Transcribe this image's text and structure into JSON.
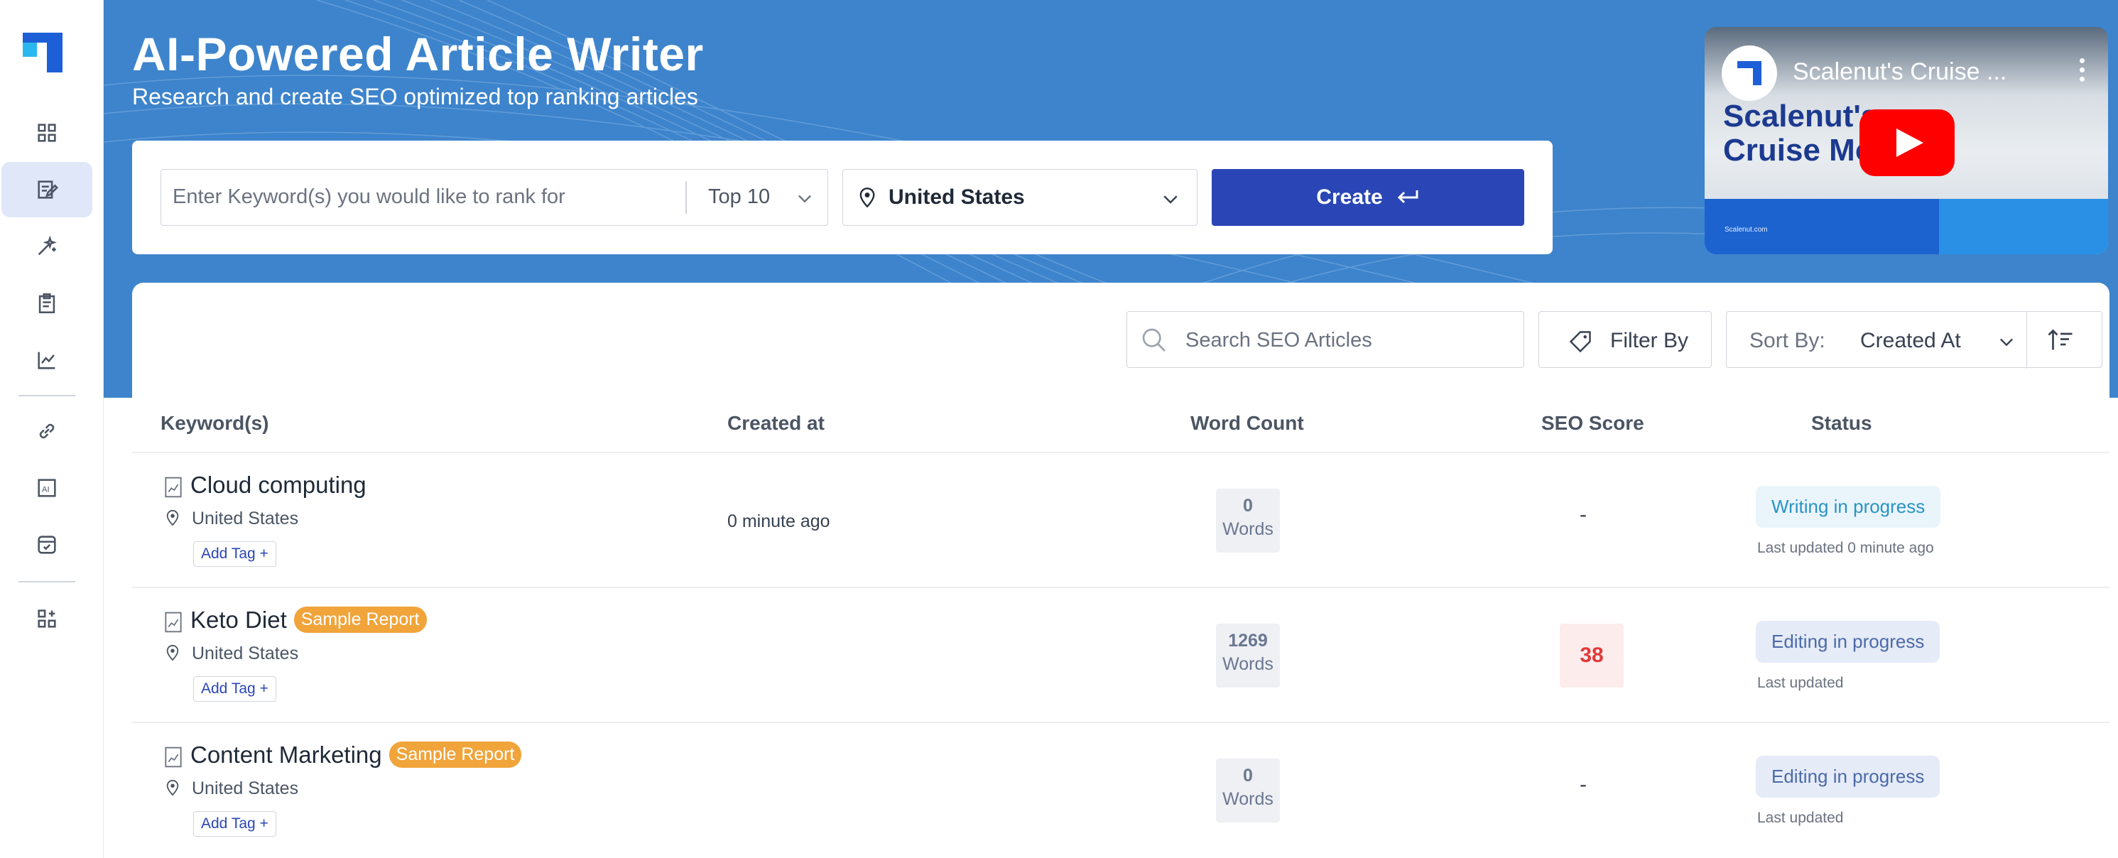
{
  "header": {
    "title": "AI-Powered Article Writer",
    "subtitle": "Research and create SEO optimized top ranking articles"
  },
  "create_form": {
    "keyword_placeholder": "Enter Keyword(s) you would like to rank for",
    "top_n": "Top 10",
    "location": "United States",
    "create_label": "Create"
  },
  "video": {
    "title": "Scalenut's Cruise ...",
    "brand_line1": "Scalenut's",
    "brand_line2": "Cruise Mo",
    "footer_text": "Scalenut.com"
  },
  "toolbar": {
    "search_placeholder": "Search SEO Articles",
    "filter_label": "Filter By",
    "sort_label": "Sort By:",
    "sort_value": "Created At"
  },
  "table": {
    "columns": [
      "Keyword(s)",
      "Created at",
      "Word Count",
      "SEO Score",
      "Status"
    ],
    "rows": [
      {
        "keyword": "Cloud computing",
        "badge": "",
        "location": "United States",
        "tag": "Add Tag +",
        "created": "0 minute ago",
        "word_count": "0",
        "words_label": "Words",
        "seo_score": "-",
        "status": "Writing in progress",
        "updated": "Last updated 0 minute ago"
      },
      {
        "keyword": "Keto Diet",
        "badge": "Sample Report",
        "location": "United States",
        "tag": "Add Tag +",
        "created": "",
        "word_count": "1269",
        "words_label": "Words",
        "seo_score": "38",
        "status": "Editing in progress",
        "updated": "Last updated"
      },
      {
        "keyword": "Content Marketing",
        "badge": "Sample Report",
        "location": "United States",
        "tag": "Add Tag +",
        "created": "",
        "word_count": "0",
        "words_label": "Words",
        "seo_score": "-",
        "status": "Editing in progress",
        "updated": "Last updated"
      }
    ]
  },
  "colors": {
    "hero_bg": "#3d84cc",
    "primary_button": "#2a46b6",
    "badge_orange": "#f0a43a",
    "score_red": "#e03a3a"
  }
}
